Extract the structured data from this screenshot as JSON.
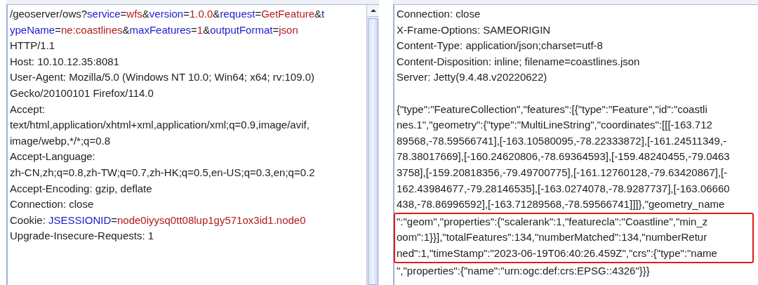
{
  "request": {
    "lines": [
      {
        "segments": [
          {
            "kind": "plain",
            "text": "/geoserver/ows?"
          },
          {
            "kind": "name",
            "text": "service"
          },
          {
            "kind": "plain",
            "text": "="
          },
          {
            "kind": "value",
            "text": "wfs"
          },
          {
            "kind": "plain",
            "text": "&"
          },
          {
            "kind": "name",
            "text": "version"
          },
          {
            "kind": "plain",
            "text": "="
          },
          {
            "kind": "value",
            "text": "1.0.0"
          },
          {
            "kind": "plain",
            "text": "&"
          },
          {
            "kind": "name",
            "text": "request"
          },
          {
            "kind": "plain",
            "text": "="
          },
          {
            "kind": "value",
            "text": "GetFeature"
          },
          {
            "kind": "plain",
            "text": "&"
          },
          {
            "kind": "name",
            "text": "t"
          }
        ]
      },
      {
        "segments": [
          {
            "kind": "name",
            "text": "ypeName"
          },
          {
            "kind": "plain",
            "text": "="
          },
          {
            "kind": "value",
            "text": "ne:coastlines"
          },
          {
            "kind": "plain",
            "text": "&"
          },
          {
            "kind": "name",
            "text": "maxFeatures"
          },
          {
            "kind": "plain",
            "text": "="
          },
          {
            "kind": "value",
            "text": "1"
          },
          {
            "kind": "plain",
            "text": "&"
          },
          {
            "kind": "name",
            "text": "outputFormat"
          },
          {
            "kind": "plain",
            "text": "="
          },
          {
            "kind": "value",
            "text": "json"
          }
        ]
      },
      {
        "segments": [
          {
            "kind": "plain",
            "text": "HTTP/1.1"
          }
        ]
      },
      {
        "segments": [
          {
            "kind": "plain",
            "text": "Host: 10.10.12.35:8081"
          }
        ]
      },
      {
        "segments": [
          {
            "kind": "plain",
            "text": "User-Agent: Mozilla/5.0 (Windows NT 10.0; Win64; x64; rv:109.0)"
          }
        ]
      },
      {
        "segments": [
          {
            "kind": "plain",
            "text": "Gecko/20100101 Firefox/114.0"
          }
        ]
      },
      {
        "segments": [
          {
            "kind": "plain",
            "text": "Accept:"
          }
        ]
      },
      {
        "segments": [
          {
            "kind": "plain",
            "text": "text/html,application/xhtml+xml,application/xml;q=0.9,image/avif,"
          }
        ]
      },
      {
        "segments": [
          {
            "kind": "plain",
            "text": "image/webp,*/*;q=0.8"
          }
        ]
      },
      {
        "segments": [
          {
            "kind": "plain",
            "text": "Accept-Language:"
          }
        ]
      },
      {
        "segments": [
          {
            "kind": "plain",
            "text": "zh-CN,zh;q=0.8,zh-TW;q=0.7,zh-HK;q=0.5,en-US;q=0.3,en;q=0.2"
          }
        ]
      },
      {
        "segments": [
          {
            "kind": "plain",
            "text": "Accept-Encoding: gzip, deflate"
          }
        ]
      },
      {
        "segments": [
          {
            "kind": "plain",
            "text": "Connection: close"
          }
        ]
      },
      {
        "segments": [
          {
            "kind": "plain",
            "text": "Cookie: "
          },
          {
            "kind": "name",
            "text": "JSESSIONID"
          },
          {
            "kind": "plain",
            "text": "="
          },
          {
            "kind": "value",
            "text": "node0iyysq0tt08lup1gy571ox3id1.node0"
          }
        ]
      },
      {
        "segments": [
          {
            "kind": "plain",
            "text": "Upgrade-Insecure-Requests: 1"
          }
        ]
      }
    ]
  },
  "response": {
    "blocks": [
      {
        "highlighted": false,
        "lines": [
          "Connection: close",
          "X-Frame-Options: SAMEORIGIN",
          "Content-Type: application/json;charset=utf-8",
          "Content-Disposition: inline; filename=coastlines.json",
          "Server: Jetty(9.4.48.v20220622)"
        ]
      },
      {
        "highlighted": false,
        "spaced": true,
        "lines": [
          "{\"type\":\"FeatureCollection\",\"features\":[{\"type\":\"Feature\",\"id\":\"coastli",
          "nes.1\",\"geometry\":{\"type\":\"MultiLineString\",\"coordinates\":[[[-163.712",
          "89568,-78.59566741],[-163.10580095,-78.22333872],[-161.24511349,-",
          "78.38017669],[-160.24620806,-78.69364593],[-159.48240455,-79.0463",
          "3758],[-159.20818356,-79.49700775],[-161.12760128,-79.63420867],[-",
          "162.43984677,-79.28146535],[-163.0274078,-78.9287737],[-163.06660",
          "438,-78.86996592],[-163.71289568,-78.59566741]]]},\"geometry_name"
        ]
      },
      {
        "highlighted": true,
        "lines": [
          "\":\"geom\",\"properties\":{\"scalerank\":1,\"featurecla\":\"Coastline\",\"min_z",
          "oom\":1}}],\"totalFeatures\":134,\"numberMatched\":134,\"numberRetur",
          "ned\":1,\"timeStamp\":\"2023-06-19T06:40:26.459Z\",\"crs\":{\"type\":\"name"
        ]
      },
      {
        "highlighted": false,
        "lines": [
          "\",\"properties\":{\"name\":\"urn:ogc:def:crs:EPSG::4326\"}}}"
        ]
      }
    ]
  }
}
